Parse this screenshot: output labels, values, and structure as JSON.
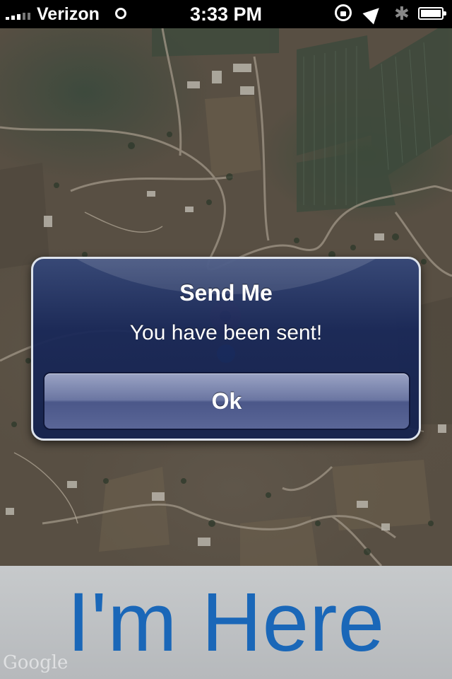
{
  "status_bar": {
    "carrier": "Verizon",
    "time": "3:33 PM",
    "icons": [
      "signal-icon",
      "wifi-icon",
      "rotation-lock-icon",
      "location-arrow-icon",
      "bluetooth-icon",
      "battery-icon"
    ]
  },
  "map": {
    "attribution": "Google",
    "markers": [
      "pin-marker-icon",
      "current-location-icon"
    ]
  },
  "alert": {
    "title": "Send Me",
    "message": "You have been sent!",
    "button_label": "Ok"
  },
  "bottom_bar": {
    "label": "I'm Here",
    "label_color": "#1a67b8"
  }
}
